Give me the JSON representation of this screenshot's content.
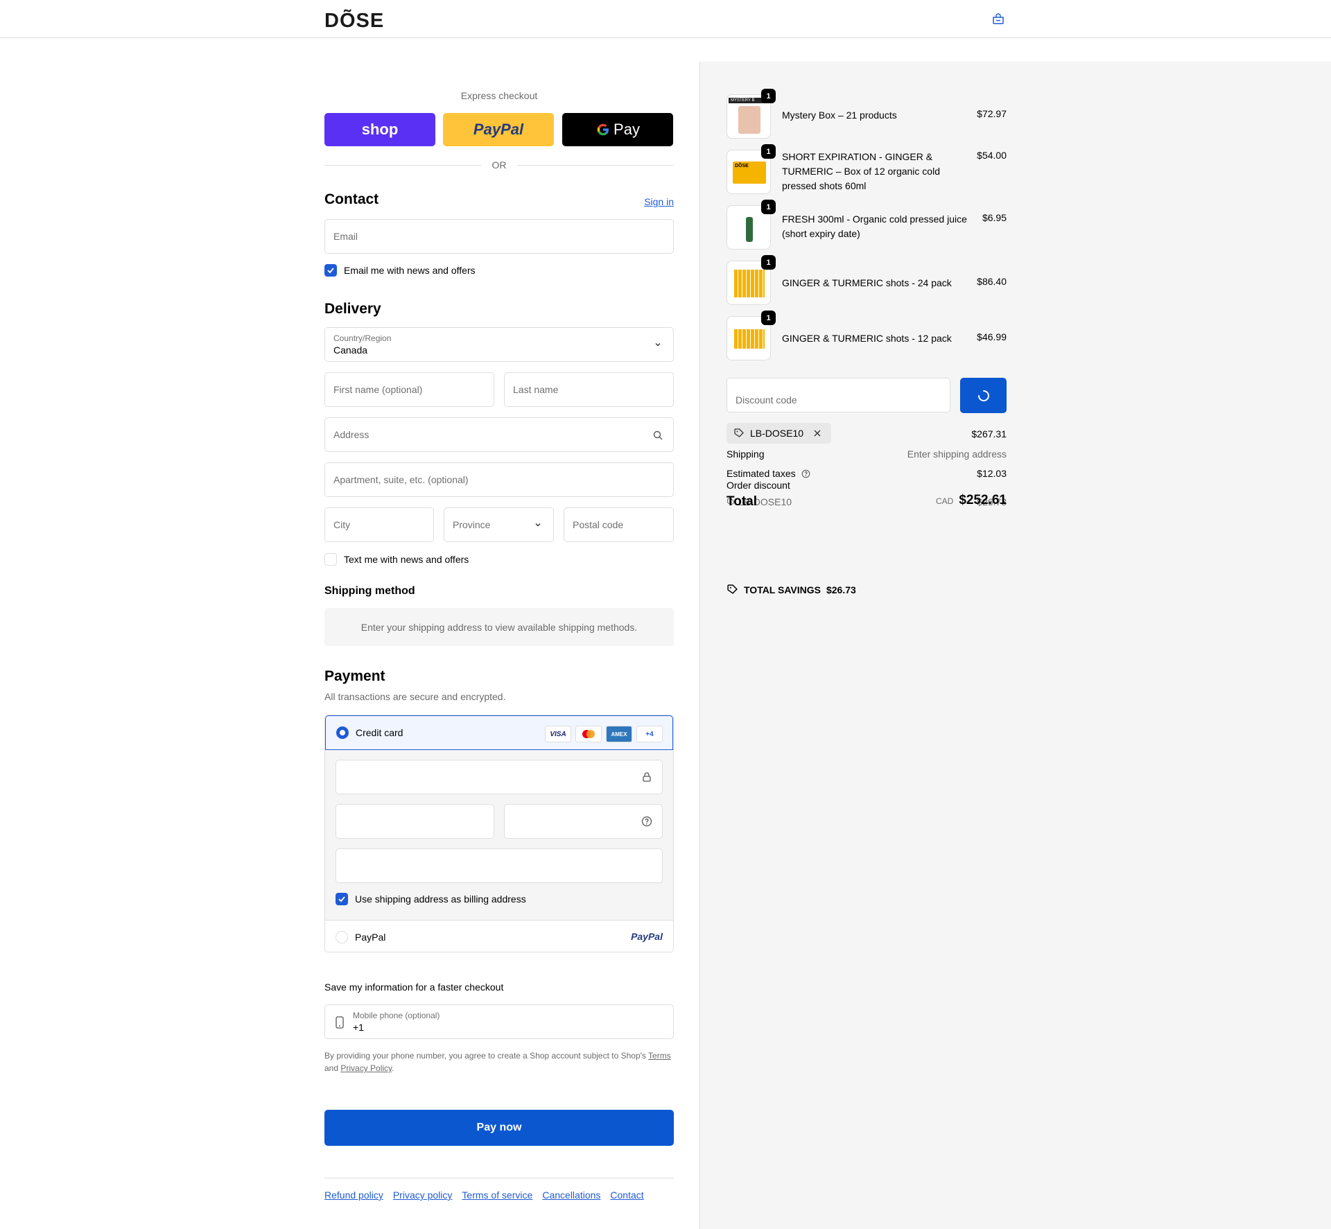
{
  "header": {
    "logo": "DÕSE"
  },
  "express": {
    "title": "Express checkout",
    "shop_label": "shop",
    "paypal_label": "PayPal",
    "gpay_label": "Pay",
    "or": "OR"
  },
  "contact": {
    "title": "Contact",
    "sign_in": "Sign in",
    "email_placeholder": "Email",
    "email_news": "Email me with news and offers"
  },
  "delivery": {
    "title": "Delivery",
    "country_label": "Country/Region",
    "country_value": "Canada",
    "first_name": "First name (optional)",
    "last_name": "Last name",
    "address": "Address",
    "apartment": "Apartment, suite, etc. (optional)",
    "city": "City",
    "province": "Province",
    "postal": "Postal code",
    "text_news": "Text me with news and offers"
  },
  "shipping": {
    "title": "Shipping method",
    "message": "Enter your shipping address to view available shipping methods."
  },
  "payment": {
    "title": "Payment",
    "subtitle": "All transactions are secure and encrypted.",
    "credit_card": "Credit card",
    "cards": [
      "VISA",
      "MC",
      "AMEX",
      "+4"
    ],
    "billing_same": "Use shipping address as billing address",
    "paypal": "PayPal",
    "paypal_logo": "PayPal"
  },
  "save": {
    "title": "Save my information for a faster checkout",
    "phone_label": "Mobile phone (optional)",
    "phone_value": "+1",
    "legal_1": "By providing your phone number, you agree to create a Shop account subject to Shop's",
    "legal_terms": "Terms",
    "legal_and": "and",
    "legal_privacy": "Privacy Policy",
    "legal_end": "."
  },
  "pay_now": "Pay now",
  "footer": [
    "Refund policy",
    "Privacy policy",
    "Terms of service",
    "Cancellations",
    "Contact"
  ],
  "summary": {
    "items": [
      {
        "name": "Mystery Box – 21 products",
        "price": "$72.97",
        "qty": "1",
        "thumb_text": "MYSTERY B"
      },
      {
        "name": "SHORT EXPIRATION - GINGER & TURMERIC – Box of 12 organic cold pressed shots 60ml",
        "price": "$54.00",
        "qty": "1",
        "thumb_text": "DÕSE"
      },
      {
        "name": "FRESH 300ml - Organic cold pressed juice (short expiry date)",
        "price": "$6.95",
        "qty": "1",
        "thumb_text": ""
      },
      {
        "name": "GINGER & TURMERIC shots - 24 pack",
        "price": "$86.40",
        "qty": "1",
        "thumb_text": ""
      },
      {
        "name": "GINGER & TURMERIC shots - 12 pack",
        "price": "$46.99",
        "qty": "1",
        "thumb_text": ""
      }
    ],
    "discount_placeholder": "Discount code",
    "applied_code": "LB-DOSE10",
    "subtotal": "$267.31",
    "shipping_label": "Shipping",
    "shipping_value": "Enter shipping address",
    "taxes_label": "Estimated taxes",
    "taxes_value": "$12.03",
    "order_discount_label": "Order discount",
    "order_discount_code": "LB-DOSE10",
    "order_discount_value": "-$26.73",
    "total_label": "Total",
    "currency": "CAD",
    "total_value": "$252.61",
    "savings_label": "TOTAL SAVINGS",
    "savings_value": "$26.73"
  },
  "colors": {
    "accent": "#1f5bd6",
    "button": "#0b57d0",
    "shop": "#5a31f4",
    "paypal": "#ffc439",
    "panel": "#f5f5f5"
  }
}
